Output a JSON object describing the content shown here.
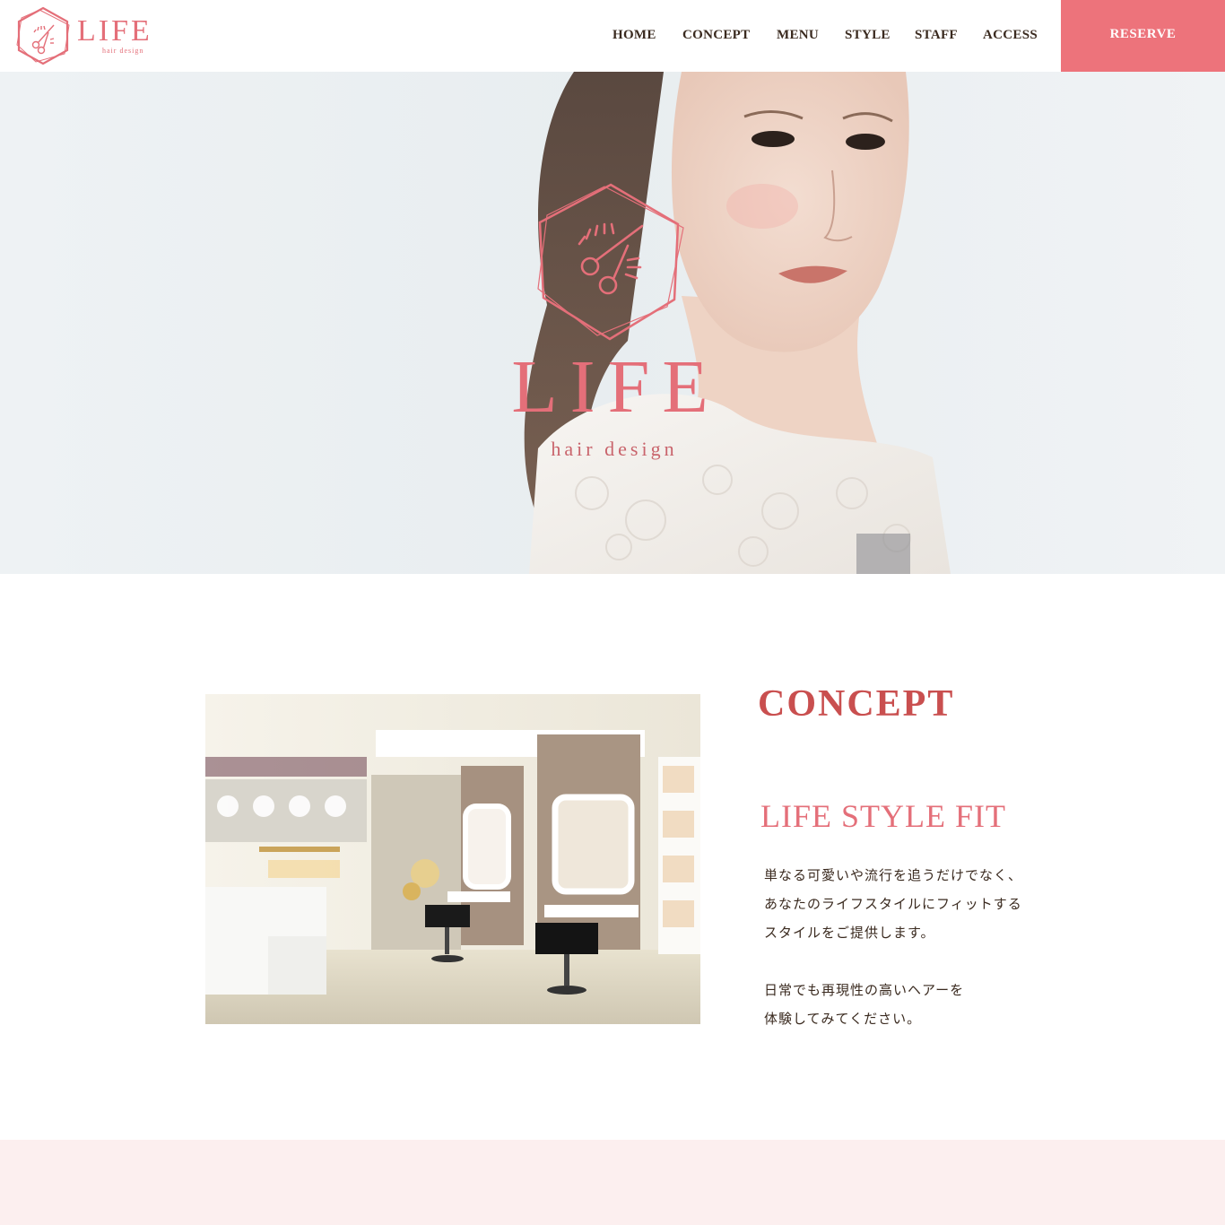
{
  "brand": {
    "name": "LIFE",
    "tagline": "hair design",
    "accent": "#e46f79"
  },
  "nav": {
    "items": [
      {
        "label": "HOME"
      },
      {
        "label": "CONCEPT"
      },
      {
        "label": "MENU"
      },
      {
        "label": "STYLE"
      },
      {
        "label": "STAFF"
      },
      {
        "label": "ACCESS"
      }
    ],
    "reserve_label": "RESERVE",
    "reserve_color": "#ed737b"
  },
  "hero": {
    "logo_word": "LIFE",
    "logo_sub": "hair design",
    "image": "woman-portrait-photo"
  },
  "concept": {
    "title": "CONCEPT",
    "subtitle": "LIFE STYLE FIT",
    "image": "salon-interior-photo",
    "paragraph1": [
      "単なる可愛いや流行を追うだけでなく、",
      "あなたのライフスタイルにフィットする",
      "スタイルをご提供します。"
    ],
    "paragraph2": [
      "日常でも再現性の高いヘアーを",
      "体験してみてください。"
    ]
  },
  "colors": {
    "title": "#c94f4f",
    "text": "#3a2a1f",
    "band": "#fcefef"
  }
}
